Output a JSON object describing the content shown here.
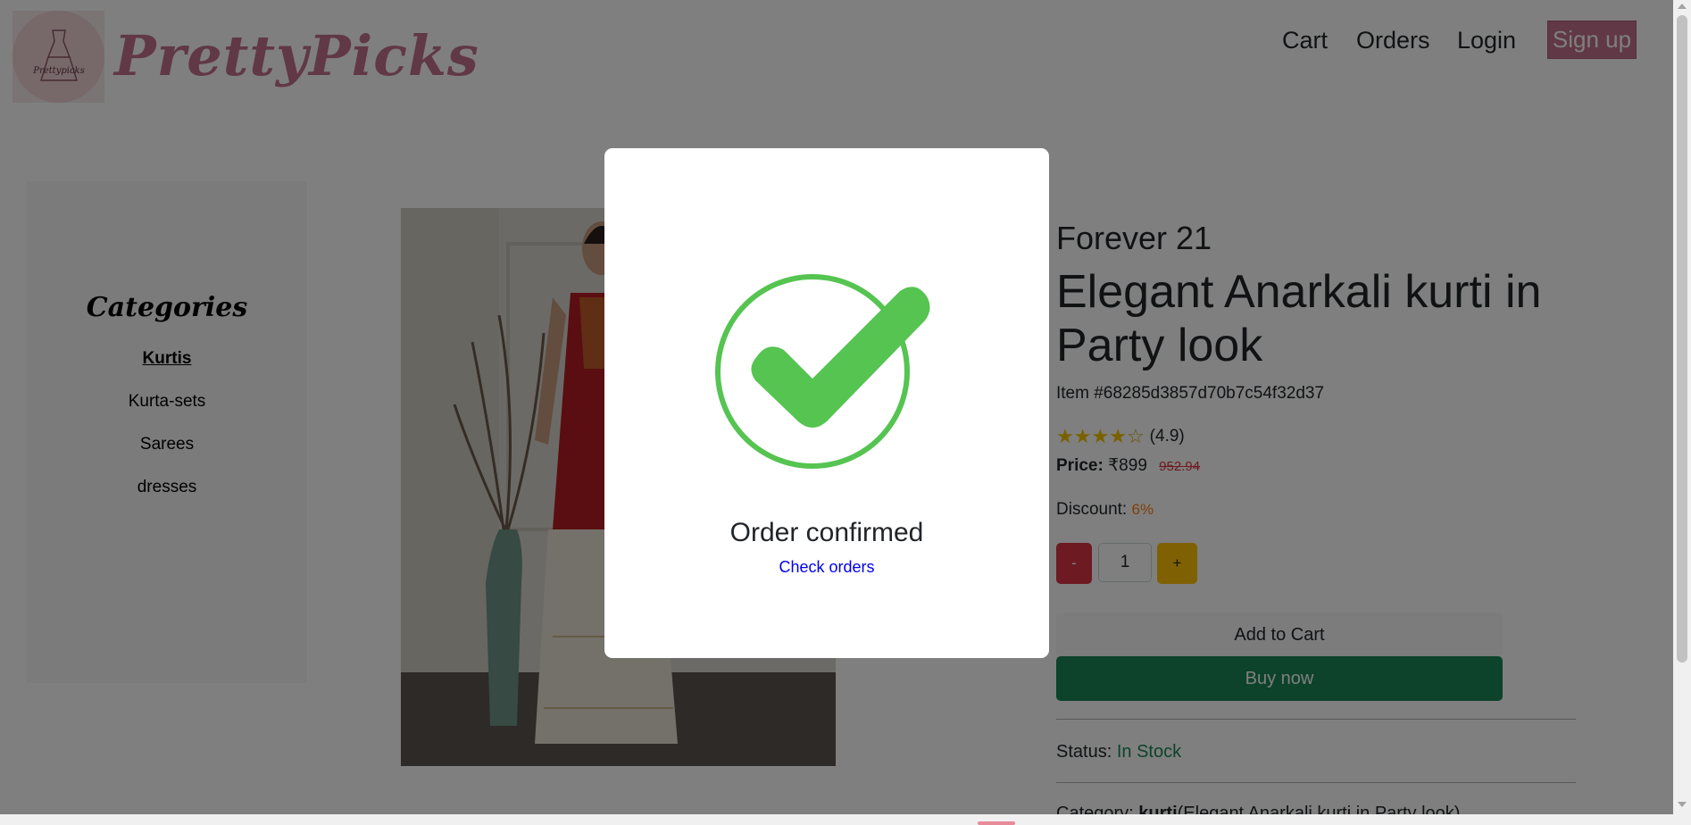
{
  "header": {
    "brand": "PrettyPicks",
    "logo_text": "Prettypicks",
    "nav": {
      "cart": "Cart",
      "orders": "Orders",
      "login": "Login",
      "signup": "Sign up"
    }
  },
  "sidebar": {
    "title": "Categories",
    "items": [
      {
        "label": "Kurtis",
        "active": true
      },
      {
        "label": "Kurta-sets",
        "active": false
      },
      {
        "label": "Sarees",
        "active": false
      },
      {
        "label": "dresses",
        "active": false
      }
    ]
  },
  "product": {
    "brand": "Forever 21",
    "title": "Elegant Anarkali kurti in Party look",
    "item_id": "Item #68285d3857d70b7c54f32d37",
    "rating": 4.9,
    "rating_label": "(4.9)",
    "stars_filled": 4,
    "stars_total": 5,
    "price_label": "Price:",
    "price": "₹899",
    "old_price": "952.94",
    "discount_label": "Discount:",
    "discount": "6%",
    "qty_minus": "-",
    "qty": "1",
    "qty_plus": "+",
    "add_to_cart": "Add to Cart",
    "buy_now": "Buy now",
    "status_label": "Status:",
    "status": "In Stock",
    "category_label": "Category:",
    "category": "kurti",
    "category_suffix": "(Elegant Anarkali kurti in Party look)"
  },
  "modal": {
    "title": "Order confirmed",
    "link": "Check orders",
    "icon": "check-circle-icon"
  },
  "colors": {
    "brand": "#c2708b",
    "success": "#198754",
    "danger": "#dc3545",
    "warning": "#ffc107",
    "check": "#55c451"
  }
}
